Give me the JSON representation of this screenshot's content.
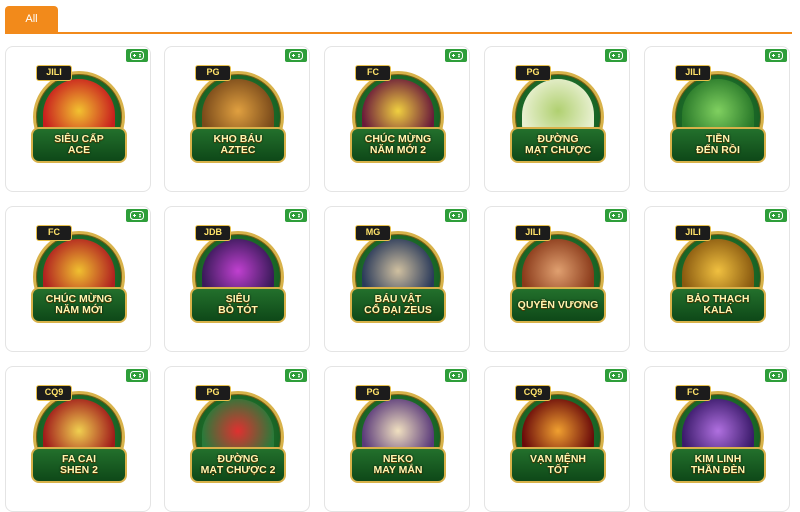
{
  "tabs": {
    "all_label": "All"
  },
  "games": [
    {
      "provider": "JILI",
      "title": "Siêu Cấp\nAce",
      "art": [
        "#c81e1e",
        "#f2c230"
      ]
    },
    {
      "provider": "PG",
      "title": "Kho Báu\nAztec",
      "art": [
        "#7a4a1a",
        "#e0a040"
      ]
    },
    {
      "provider": "FC",
      "title": "Chúc Mừng\nNăm Mới 2",
      "art": [
        "#6a1a3a",
        "#f0d040"
      ]
    },
    {
      "provider": "PG",
      "title": "Đường\nMạt Chược",
      "art": [
        "#e8f0d0",
        "#b0d070"
      ]
    },
    {
      "provider": "JILI",
      "title": "Tiền\nĐến Rồi",
      "art": [
        "#2a7a2a",
        "#80d060"
      ]
    },
    {
      "provider": "FC",
      "title": "Chúc Mừng\nNăm Mới",
      "art": [
        "#b02020",
        "#f0c030"
      ]
    },
    {
      "provider": "JDB",
      "title": "Siêu\nBò Tót",
      "art": [
        "#3a1a5a",
        "#c040d0"
      ]
    },
    {
      "provider": "MG",
      "title": "Báu Vật\nCổ Đại Zeus",
      "art": [
        "#2a3a5a",
        "#d0c0a0"
      ]
    },
    {
      "provider": "JILI",
      "title": "Quyền Vương",
      "art": [
        "#8a3a1a",
        "#e0a070"
      ]
    },
    {
      "provider": "JILI",
      "title": "Bảo Thạch\nKala",
      "art": [
        "#8a5a10",
        "#f0c040"
      ]
    },
    {
      "provider": "CQ9",
      "title": "Fa Cai\nShen 2",
      "art": [
        "#a01a1a",
        "#f0d050"
      ]
    },
    {
      "provider": "PG",
      "title": "Đường\nMạt Chược 2",
      "art": [
        "#2a7a3a",
        "#e03030"
      ]
    },
    {
      "provider": "PG",
      "title": "Neko\nMay Mắn",
      "art": [
        "#5a3a7a",
        "#f0e0c0"
      ]
    },
    {
      "provider": "CQ9",
      "title": "Vạn Mệnh\nTốt",
      "art": [
        "#6a0a0a",
        "#f0a030"
      ]
    },
    {
      "provider": "FC",
      "title": "Kim Linh\nThần Đèn",
      "art": [
        "#3a1a6a",
        "#b070e0"
      ]
    }
  ],
  "colors": {
    "accent": "#f28a1b",
    "play_badge": "#2e9e3a",
    "ring_gold": "#d8b24a"
  },
  "icons": {
    "play_badge": "gamepad-icon"
  }
}
